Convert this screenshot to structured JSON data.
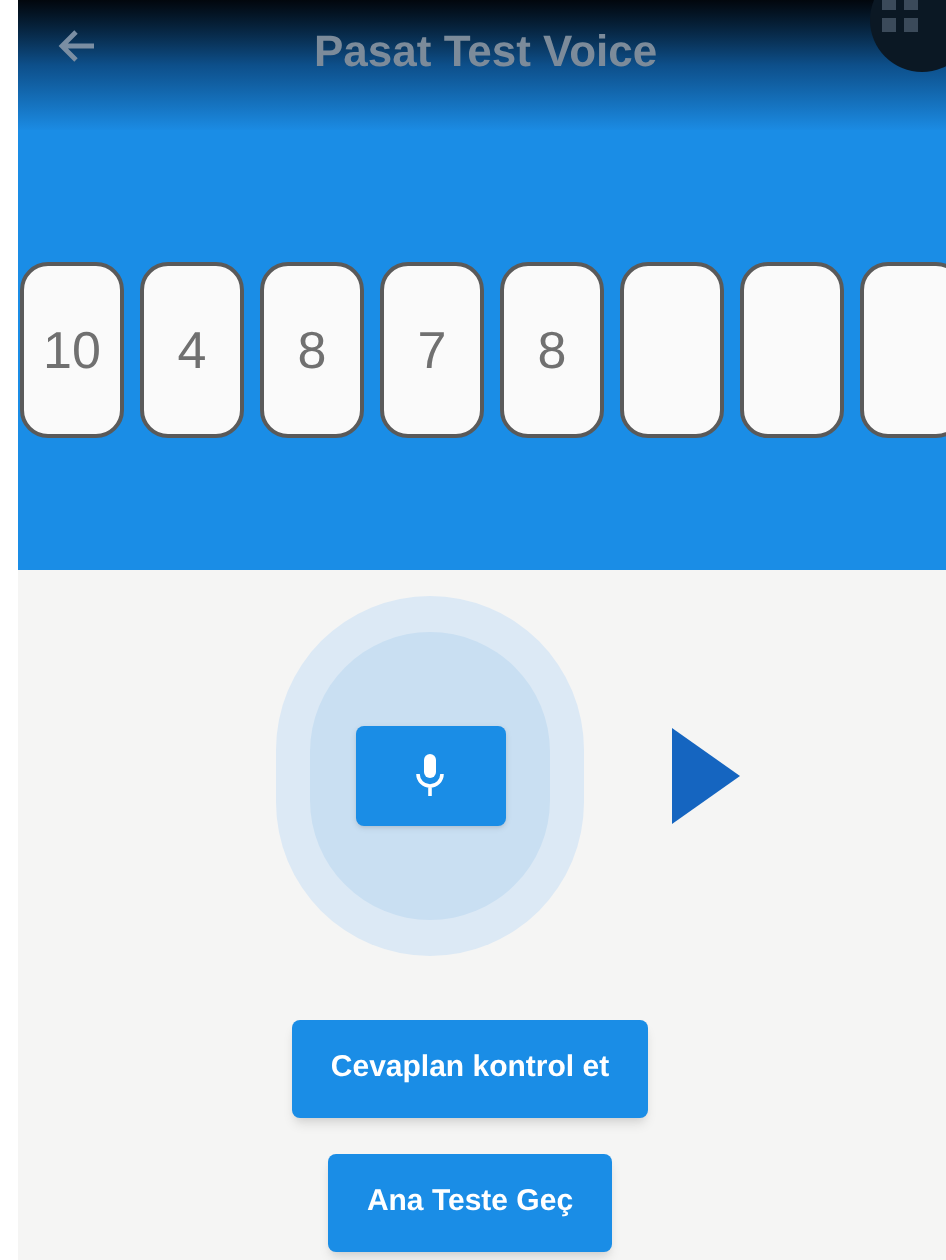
{
  "app_bar": {
    "title": "Pasat Test Voice"
  },
  "answer_cards": [
    {
      "kind": "filled",
      "value": "10"
    },
    {
      "kind": "filled",
      "value": "4"
    },
    {
      "kind": "filled",
      "value": "8"
    },
    {
      "kind": "filled",
      "value": "7"
    },
    {
      "kind": "filled",
      "value": "8"
    },
    {
      "kind": "empty"
    },
    {
      "kind": "empty"
    },
    {
      "kind": "empty"
    }
  ],
  "buttons": [
    "Cevaplan kontrol et",
    "Ana Teste Geç"
  ]
}
